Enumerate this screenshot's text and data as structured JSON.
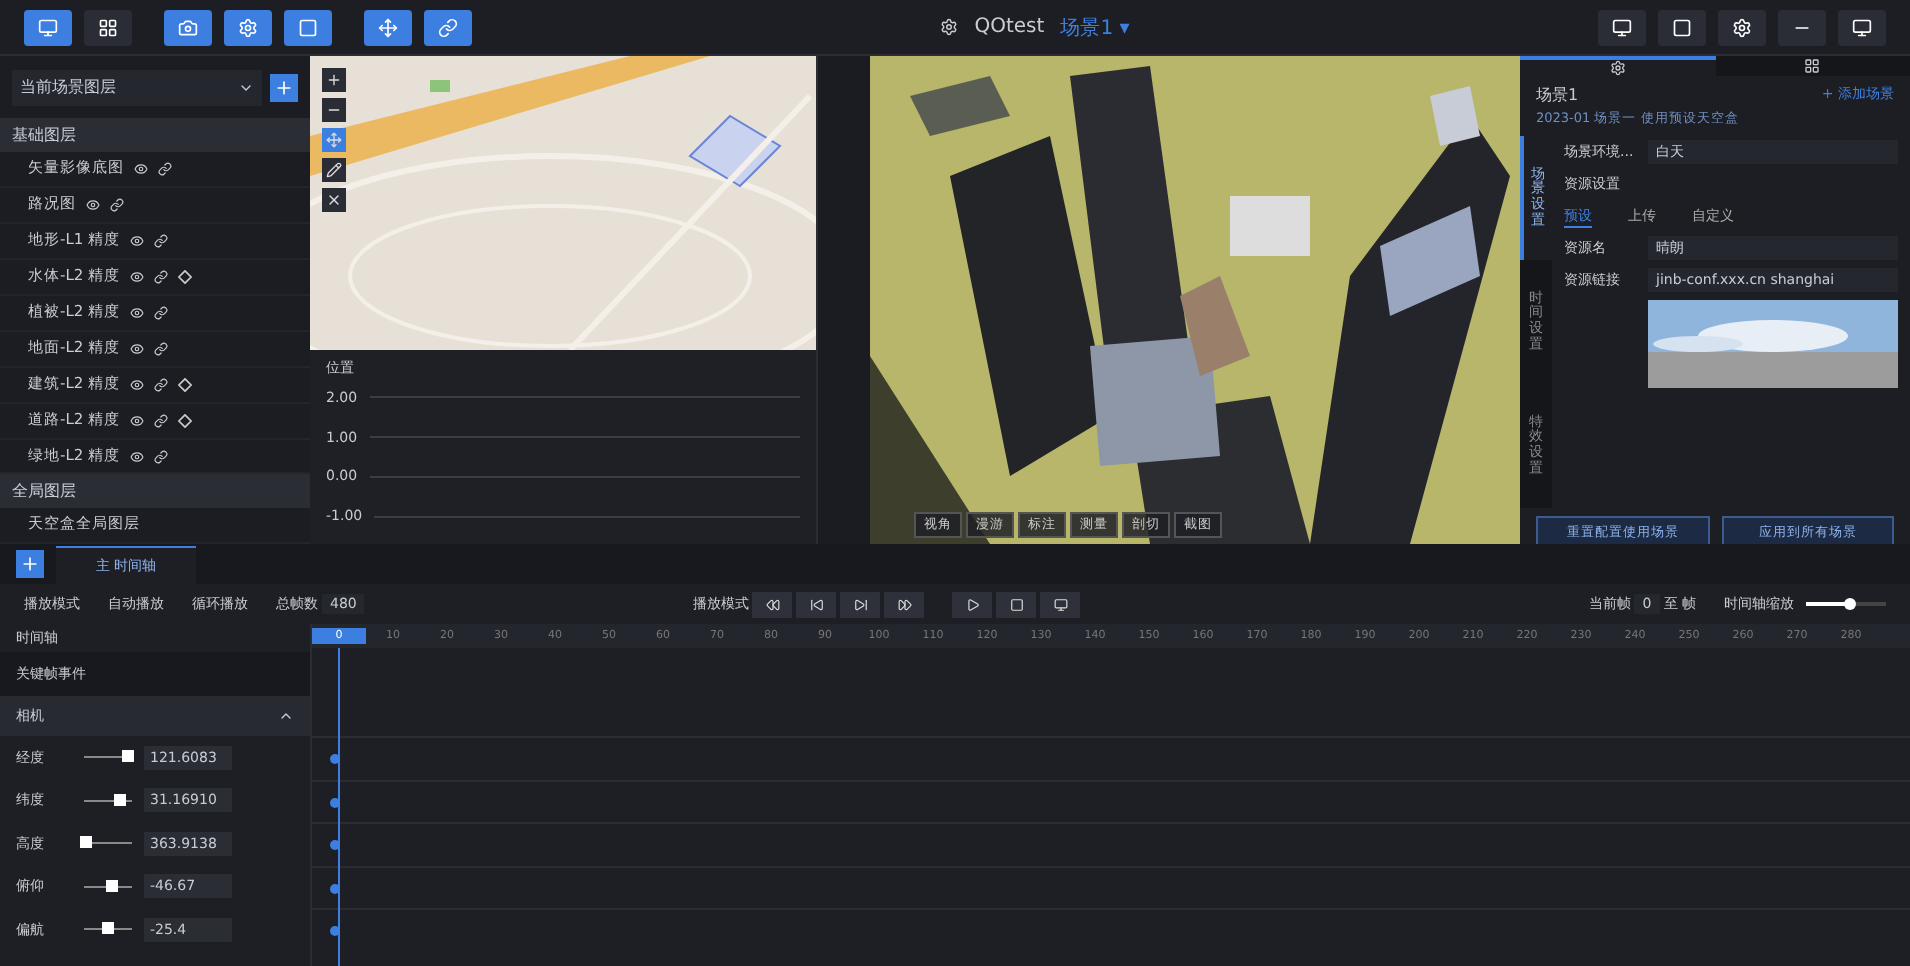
{
  "topbar": {
    "left_buttons": [
      {
        "selected": true
      },
      {
        "selected": false
      },
      {
        "selected": true
      },
      {
        "selected": true
      },
      {
        "selected": true
      },
      {
        "selected": true
      },
      {
        "selected": true
      }
    ],
    "title": "QOtest",
    "scene": "场景1 ▾"
  },
  "layers": {
    "select": "当前场景图层",
    "sections": [
      {
        "title": "基础图层",
        "items": [
          {
            "name": "矢量影像底图",
            "keyframe": false
          },
          {
            "name": "路况图",
            "keyframe": false
          },
          {
            "name": "地形-L1 精度",
            "keyframe": false
          },
          {
            "name": "水体-L2 精度",
            "keyframe": true
          },
          {
            "name": "植被-L2 精度",
            "keyframe": false
          },
          {
            "name": "地面-L2 精度",
            "keyframe": false
          },
          {
            "name": "建筑-L2 精度",
            "keyframe": true
          },
          {
            "name": "道路-L2 精度",
            "keyframe": true
          },
          {
            "name": "绿地-L2 精度",
            "keyframe": false
          }
        ]
      },
      {
        "title": "全局图层",
        "items": [
          {
            "name": "天空盒全局图层",
            "plain": true
          }
        ]
      }
    ]
  },
  "curve": {
    "title": "位置",
    "ticks": [
      "2.00",
      "1.00",
      "0.00",
      "-1.00"
    ]
  },
  "viewport": {
    "toolbar": [
      "视角",
      "漫游",
      "标注",
      "测量",
      "剖切",
      "截图"
    ]
  },
  "panel": {
    "scene": "场景1",
    "add": "+ 添加场景",
    "subtitle": "2023-01 场景一 使用预设天空盒",
    "side_tabs": [
      {
        "label": "场景设置",
        "selected": true
      },
      {
        "label": "时间设置",
        "selected": false
      },
      {
        "label": "特效设置",
        "selected": false
      }
    ],
    "env_label": "场景环境...",
    "env_value": "白天",
    "res_label": "资源设置",
    "sub_tabs": [
      {
        "label": "预设",
        "selected": true
      },
      {
        "label": "上传",
        "selected": false
      },
      {
        "label": "自定义",
        "selected": false
      }
    ],
    "name_label": "资源名",
    "name_value": "晴朗",
    "link_label": "资源链接",
    "link_value": "jinb-conf.xxx.cn shanghai",
    "buttons": [
      "重置配置使用场景",
      "应用到所有场景"
    ]
  },
  "timeline": {
    "tab": "主 时间轴",
    "options": [
      "播放模式",
      "自动播放",
      "循环播放"
    ],
    "frames_label": "总帧数",
    "frames": "480",
    "mode_label": "播放模式",
    "frame_label": "当前帧",
    "frame": "0",
    "to": "至 帧",
    "zoom_label": "时间轴缩放",
    "zoom": {
      "level": 0.55
    },
    "header": "时间轴",
    "event": "关键帧事件",
    "group": "相机",
    "expanded": true,
    "params": [
      {
        "name": "经度",
        "value": "121.6083",
        "level": 0.9
      },
      {
        "name": "纬度",
        "value": "31.16910",
        "level": 0.75
      },
      {
        "name": "高度",
        "value": "363.9138",
        "level": 0.05
      },
      {
        "name": "俯仰",
        "value": "-46.67",
        "level": 0.6
      },
      {
        "name": "偏航",
        "value": "-25.4",
        "level": 0.5
      }
    ],
    "ticks": [
      "0",
      "10",
      "20",
      "30",
      "40",
      "50",
      "60",
      "70",
      "80",
      "90",
      "100",
      "110",
      "120",
      "130",
      "140",
      "150",
      "160",
      "170",
      "180",
      "190",
      "200",
      "210",
      "220",
      "230",
      "240",
      "250",
      "260",
      "270",
      "280"
    ]
  }
}
